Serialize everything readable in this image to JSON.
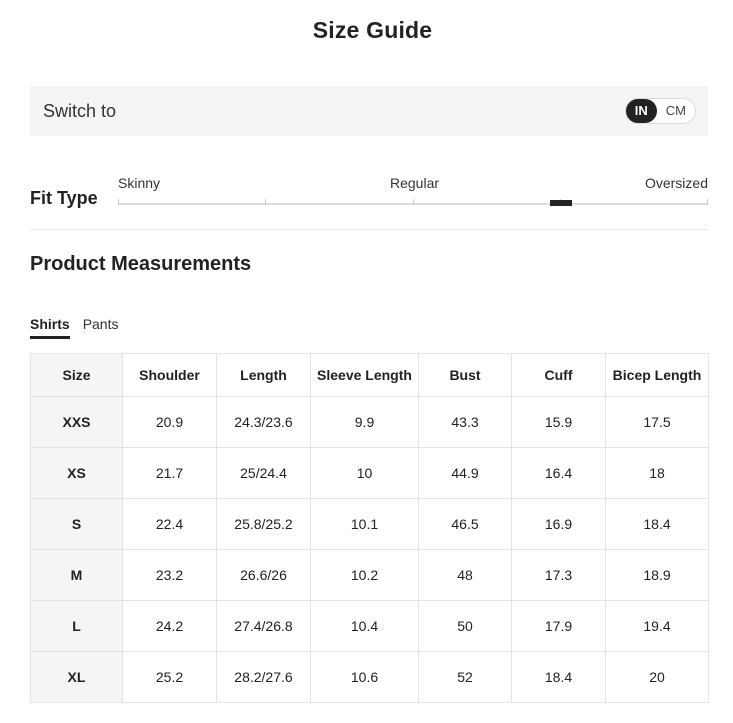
{
  "title": "Size Guide",
  "switch": {
    "label": "Switch to",
    "options": [
      "IN",
      "CM"
    ],
    "selected": "IN"
  },
  "fit": {
    "label": "Fit Type",
    "scale": [
      "Skinny",
      "Regular",
      "Oversized"
    ],
    "level": 0.75
  },
  "measurements": {
    "title": "Product Measurements",
    "tabs": [
      "Shirts",
      "Pants"
    ],
    "active_tab": "Shirts"
  },
  "table": {
    "headers": [
      "Size",
      "Shoulder",
      "Length",
      "Sleeve Length",
      "Bust",
      "Cuff",
      "Bicep Length"
    ],
    "rows": [
      [
        "XXS",
        "20.9",
        "24.3/23.6",
        "9.9",
        "43.3",
        "15.9",
        "17.5"
      ],
      [
        "XS",
        "21.7",
        "25/24.4",
        "10",
        "44.9",
        "16.4",
        "18"
      ],
      [
        "S",
        "22.4",
        "25.8/25.2",
        "10.1",
        "46.5",
        "16.9",
        "18.4"
      ],
      [
        "M",
        "23.2",
        "26.6/26",
        "10.2",
        "48",
        "17.3",
        "18.9"
      ],
      [
        "L",
        "24.2",
        "27.4/26.8",
        "10.4",
        "50",
        "17.9",
        "19.4"
      ],
      [
        "XL",
        "25.2",
        "28.2/27.6",
        "10.6",
        "52",
        "18.4",
        "20"
      ]
    ]
  }
}
